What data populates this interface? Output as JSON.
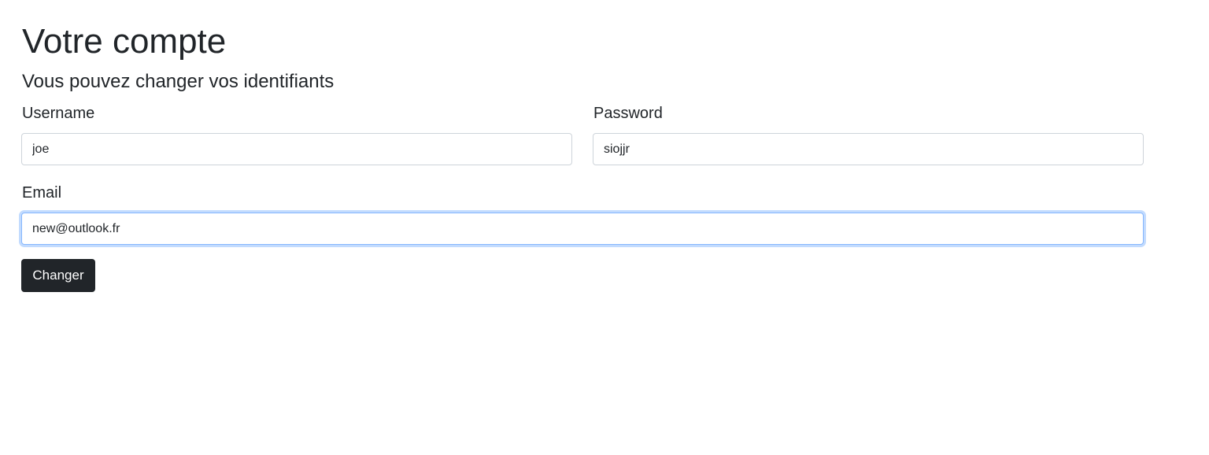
{
  "page": {
    "title": "Votre compte",
    "subtitle": "Vous pouvez changer vos identifiants"
  },
  "form": {
    "username_label": "Username",
    "username_value": "joe",
    "password_label": "Password",
    "password_value": "siojjr",
    "email_label": "Email",
    "email_value": "new@outlook.fr",
    "submit_label": "Changer"
  },
  "colors": {
    "button_bg": "#212529",
    "focus_border": "#86b7fe",
    "text": "#212529"
  }
}
